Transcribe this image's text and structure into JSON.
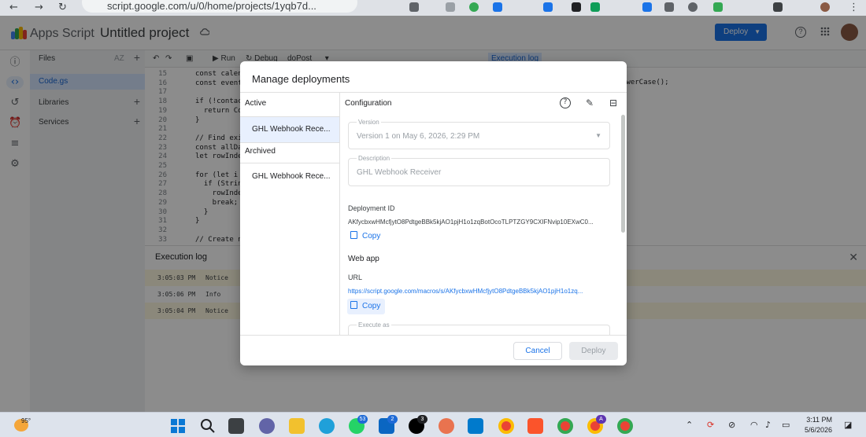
{
  "browser": {
    "url": "script.google.com/u/0/home/projects/1yqb7d..."
  },
  "header": {
    "app_name": "Apps Script",
    "project_title": "Untitled project",
    "deploy_label": "Deploy"
  },
  "files_panel": {
    "files_label": "Files",
    "sort_label": "AZ",
    "file": "Code.gs",
    "libraries_label": "Libraries",
    "services_label": "Services"
  },
  "toolbar": {
    "run_label": "Run",
    "debug_label": "Debug",
    "function_name": "doPost",
    "execution_log_label": "Execution log"
  },
  "editor": {
    "lines": [
      {
        "n": "15",
        "code": "const calen"
      },
      {
        "n": "16",
        "code": "const event"
      },
      {
        "n": "17",
        "code": ""
      },
      {
        "n": "18",
        "code": "if (!contac"
      },
      {
        "n": "19",
        "code": "  return Co"
      },
      {
        "n": "20",
        "code": "}"
      },
      {
        "n": "21",
        "code": ""
      },
      {
        "n": "22",
        "code": "// Find exi"
      },
      {
        "n": "23",
        "code": "const allDa"
      },
      {
        "n": "24",
        "code": "let rowInde"
      },
      {
        "n": "25",
        "code": ""
      },
      {
        "n": "26",
        "code": "for (let i"
      },
      {
        "n": "27",
        "code": "  if (Strin"
      },
      {
        "n": "28",
        "code": "    rowInde"
      },
      {
        "n": "29",
        "code": "    break;"
      },
      {
        "n": "30",
        "code": "  }"
      },
      {
        "n": "31",
        "code": "}"
      },
      {
        "n": "32",
        "code": ""
      },
      {
        "n": "33",
        "code": "// Create ne"
      }
    ],
    "right_fragment": "owerCase();"
  },
  "execution_log": {
    "title": "Execution log",
    "rows": [
      {
        "time": "3:05:03 PM",
        "level": "Notice"
      },
      {
        "time": "3:05:06 PM",
        "level": "Info"
      },
      {
        "time": "3:05:04 PM",
        "level": "Notice"
      }
    ]
  },
  "modal": {
    "title": "Manage deployments",
    "active_label": "Active",
    "active_item": "GHL Webhook Rece...",
    "archived_label": "Archived",
    "archived_item": "GHL Webhook Rece...",
    "config_label": "Configuration",
    "version_label": "Version",
    "version_value": "Version 1 on May 6, 2026, 2:29 PM",
    "description_label": "Description",
    "description_value": "GHL Webhook Receiver",
    "deployment_id_label": "Deployment ID",
    "deployment_id_value": "AKfycbxwHMcfjytO8PdtgeBBk5kjAO1pjH1o1zqBotOcoTLPTZGY9CXIFNvip10EXwC0...",
    "copy_label": "Copy",
    "web_app_label": "Web app",
    "url_label": "URL",
    "url_value": "https://script.google.com/macros/s/AKfycbxwHMcfjytO8PdtgeBBk5kjAO1pjH1o1zq...",
    "execute_as_label": "Execute as",
    "cancel_label": "Cancel",
    "deploy_label": "Deploy"
  },
  "taskbar": {
    "temperature": "95°",
    "whatsapp_badge": "53",
    "linkedin_badge": "2",
    "x_badge": "3",
    "chrome_badge": "A",
    "time": "3:11 PM",
    "date": "5/6/2026"
  }
}
